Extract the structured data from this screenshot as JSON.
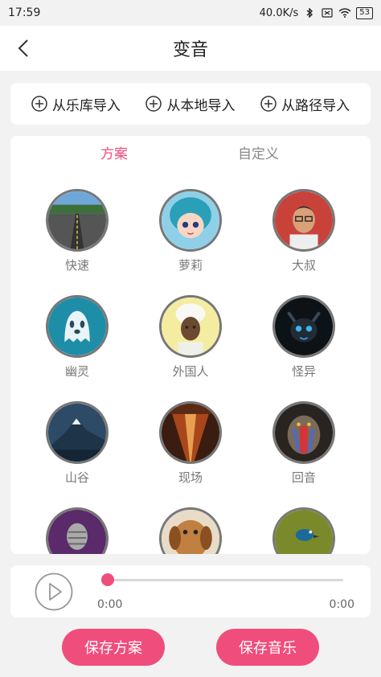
{
  "status": {
    "time": "17:59",
    "speed": "40.0K/s",
    "battery": "53"
  },
  "header": {
    "title": "变音"
  },
  "imports": [
    {
      "label": "从乐库导入"
    },
    {
      "label": "从本地导入"
    },
    {
      "label": "从路径导入"
    }
  ],
  "tabs": {
    "scheme": "方案",
    "custom": "自定义",
    "active": "scheme"
  },
  "effects": [
    {
      "label": "快速"
    },
    {
      "label": "萝莉"
    },
    {
      "label": "大叔"
    },
    {
      "label": "幽灵"
    },
    {
      "label": "外国人"
    },
    {
      "label": "怪异"
    },
    {
      "label": "山谷"
    },
    {
      "label": "现场"
    },
    {
      "label": "回音"
    }
  ],
  "player": {
    "time_current": "0:00",
    "time_total": "0:00",
    "progress": 0
  },
  "buttons": {
    "save_scheme": "保存方案",
    "save_music": "保存音乐"
  },
  "colors": {
    "accent": "#ef4d7c"
  }
}
